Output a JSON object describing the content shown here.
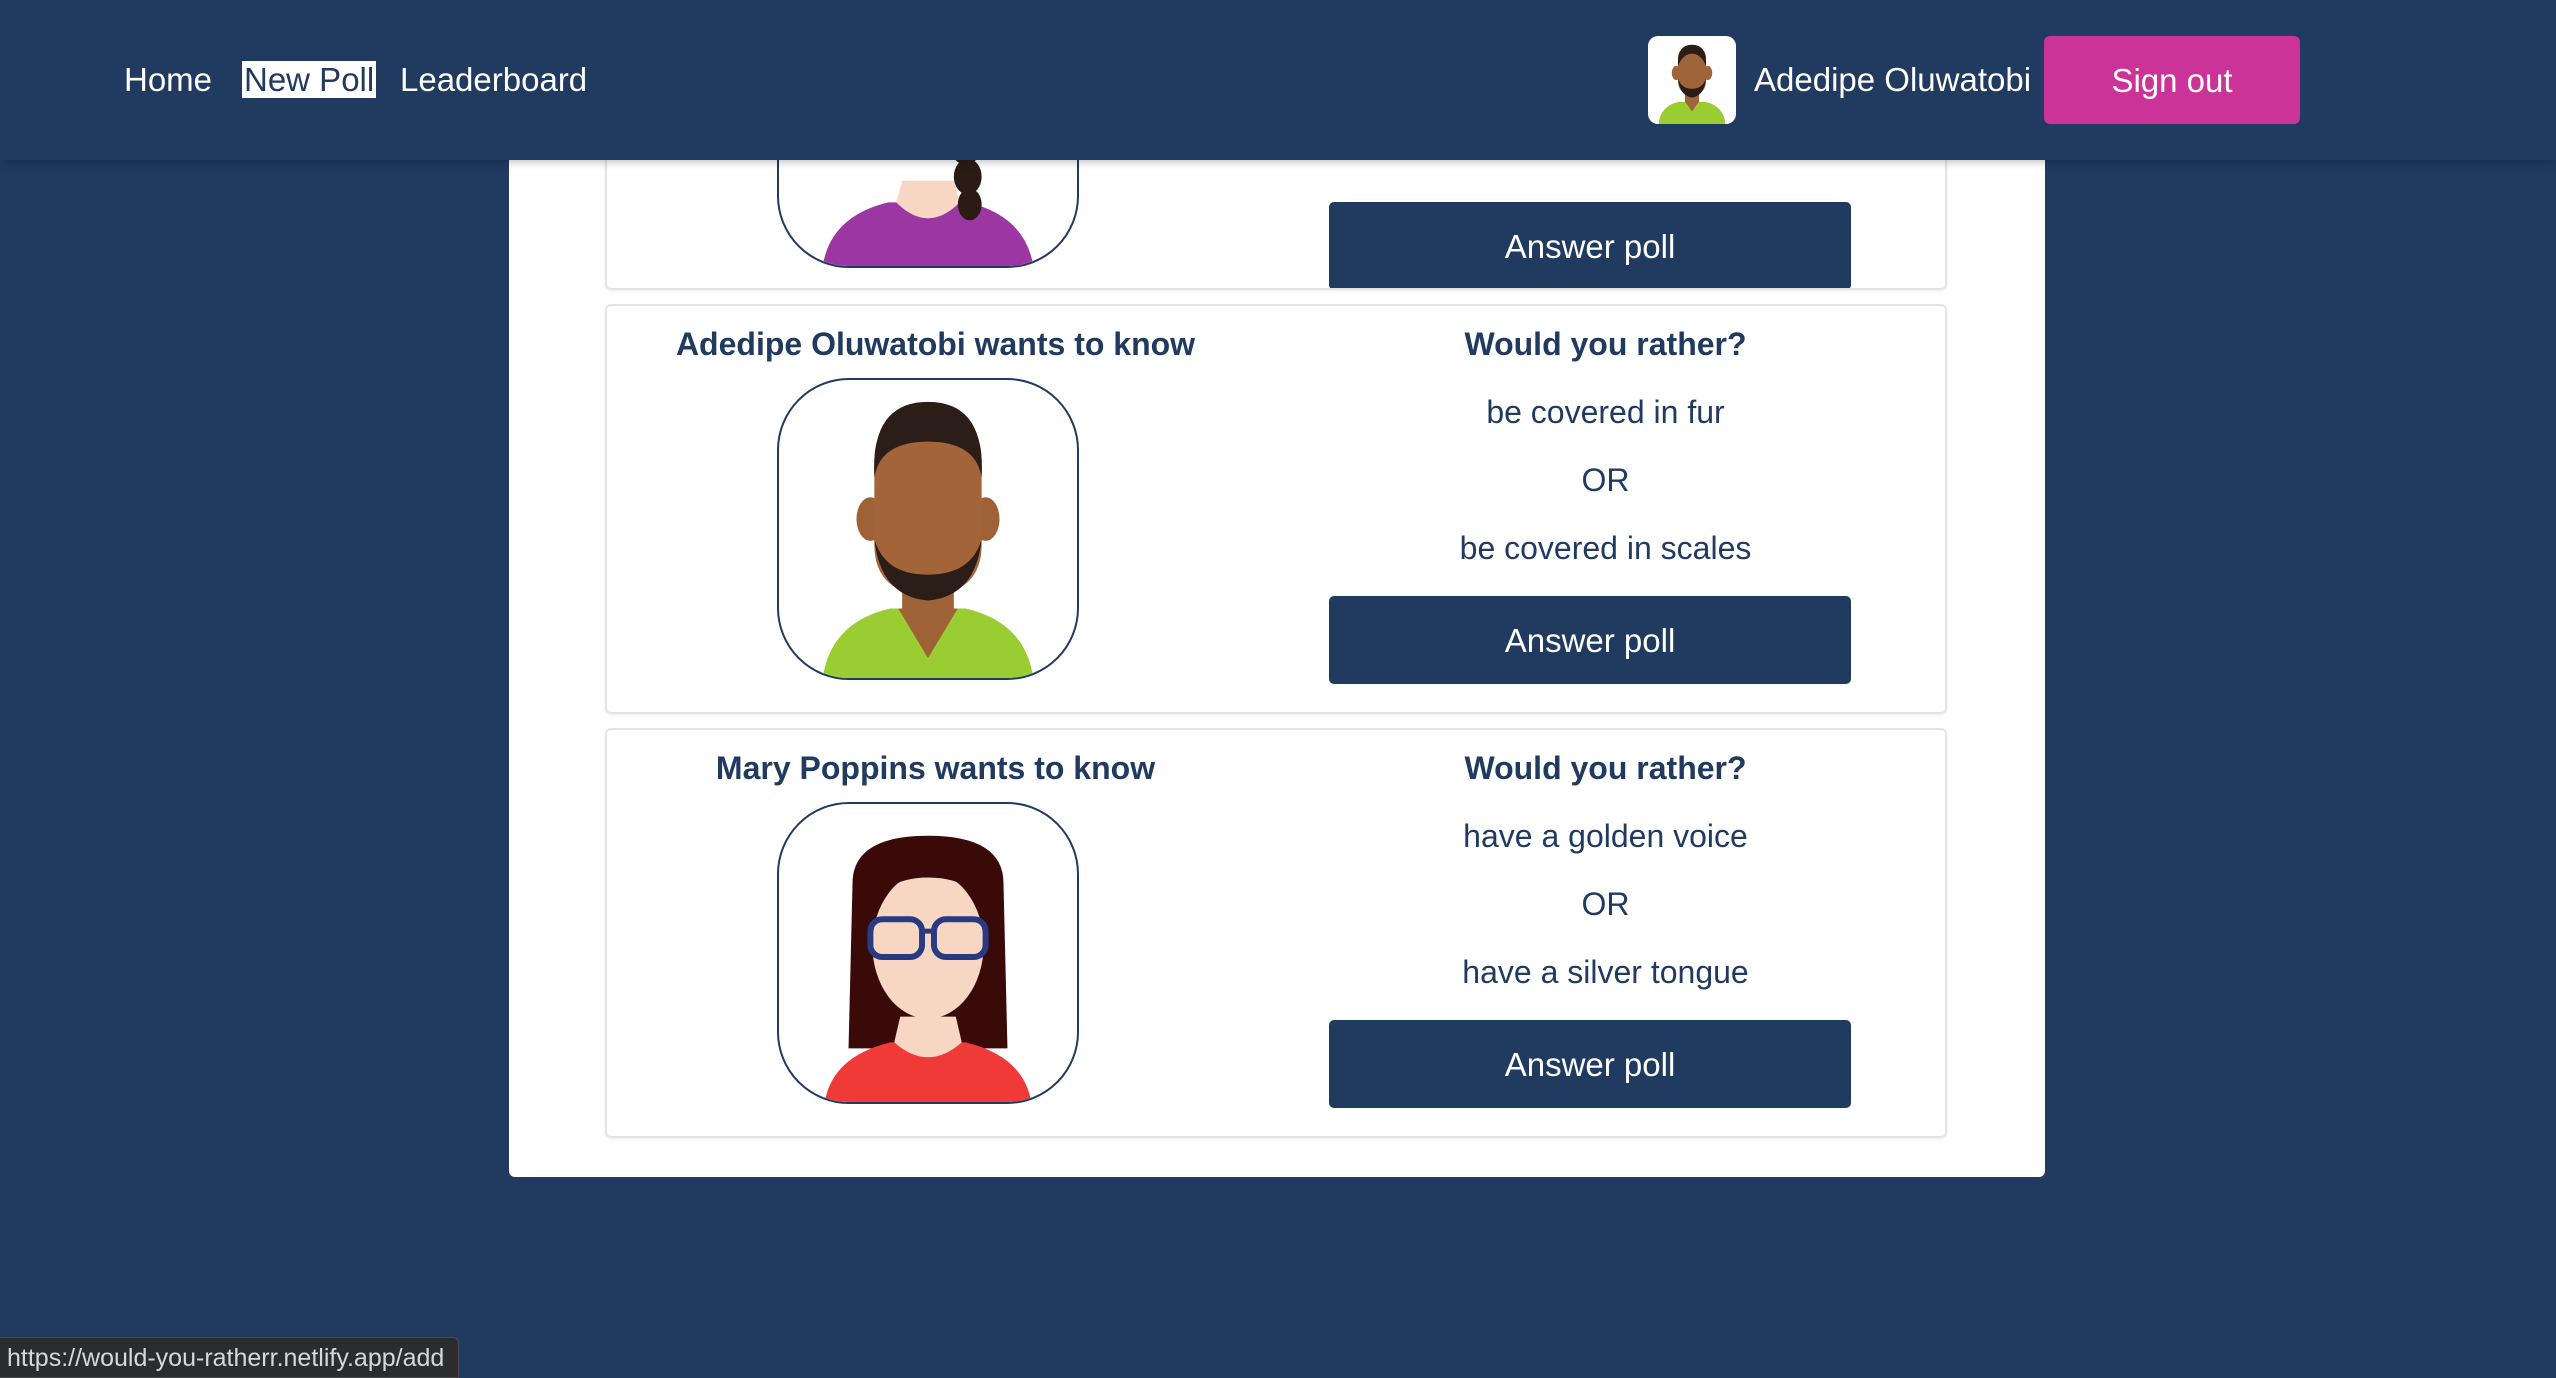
{
  "nav": {
    "links": [
      "Home",
      "New Poll",
      "Leaderboard"
    ],
    "user_name": "Adedipe Oluwatobi",
    "signout_label": "Sign out"
  },
  "polls": [
    {
      "asker": "",
      "question": "",
      "option_a": "",
      "or_text": "",
      "option_b": "",
      "button_label": "Answer poll"
    },
    {
      "asker": "Adedipe Oluwatobi wants to know",
      "question": "Would you rather?",
      "option_a": "be covered in fur",
      "or_text": "OR",
      "option_b": "be covered in scales",
      "button_label": "Answer poll"
    },
    {
      "asker": "Mary Poppins wants to know",
      "question": "Would you rather?",
      "option_a": "have a golden voice",
      "or_text": "OR",
      "option_b": "have a silver tongue",
      "button_label": "Answer poll"
    }
  ],
  "status_url": "https://would-you-ratherr.netlify.app/add",
  "colors": {
    "navy": "#213a5f",
    "signout_pink": "#cc3399",
    "panel_white": "#ffffff"
  },
  "icons": {
    "user_avatar": "avatar-man-beard-green-shirt-icon",
    "poll_avatars": [
      "avatar-woman-braid-purple-icon",
      "avatar-man-beard-green-shirt-icon",
      "avatar-woman-glasses-red-icon"
    ]
  }
}
